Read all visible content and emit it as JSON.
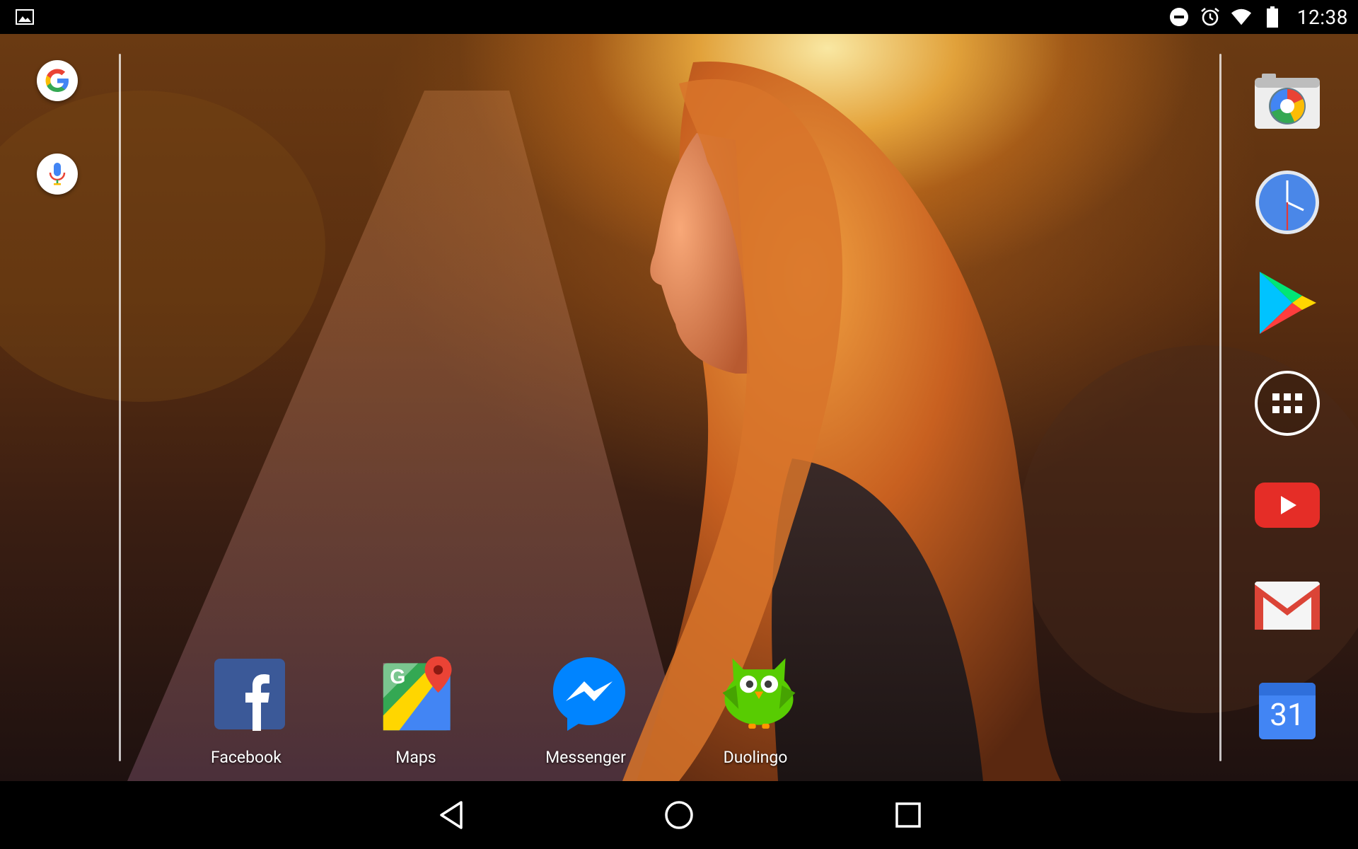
{
  "status_bar": {
    "time": "12:38",
    "left_icons": [
      "image-notification-icon"
    ],
    "right_icons": [
      "do-not-disturb-icon",
      "alarm-icon",
      "wifi-icon",
      "battery-icon"
    ]
  },
  "wallpaper": {
    "description_colors": {
      "glow": "#ffd27a",
      "warm": "#c8661e",
      "dark": "#1e1110"
    }
  },
  "search": {
    "google_icon": "google-icon",
    "voice_icon": "microphone-icon"
  },
  "home_apps": [
    {
      "label": "Facebook",
      "icon": "facebook-icon",
      "color": "#3b5998"
    },
    {
      "label": "Maps",
      "icon": "maps-icon",
      "color": "#4285f4"
    },
    {
      "label": "Messenger",
      "icon": "messenger-icon",
      "color": "#0084ff"
    },
    {
      "label": "Duolingo",
      "icon": "duolingo-icon",
      "color": "#58cc02"
    }
  ],
  "dock": [
    {
      "icon": "camera-icon"
    },
    {
      "icon": "clock-icon"
    },
    {
      "icon": "play-store-icon"
    },
    {
      "icon": "app-drawer-icon"
    },
    {
      "icon": "youtube-icon"
    },
    {
      "icon": "gmail-icon"
    },
    {
      "icon": "calendar-icon",
      "text": "31"
    }
  ],
  "nav_bar": {
    "buttons": [
      "back-icon",
      "home-icon",
      "recents-icon"
    ]
  }
}
